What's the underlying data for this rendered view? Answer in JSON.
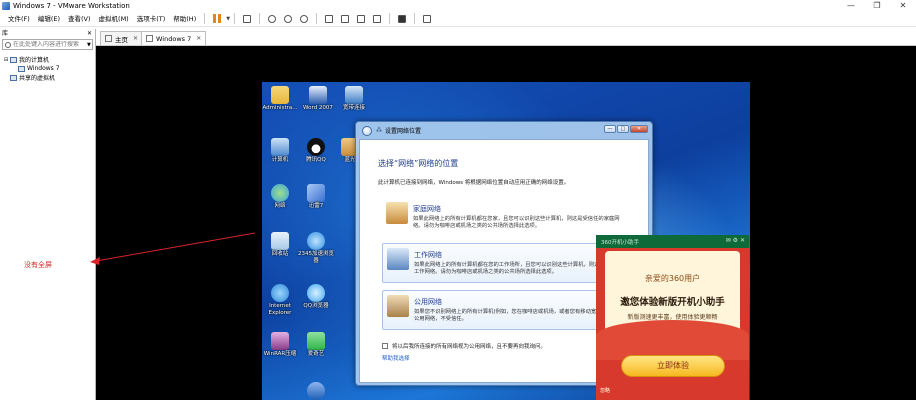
{
  "window": {
    "title": "Windows 7 - VMware Workstation",
    "controls": [
      "—",
      "❐",
      "✕"
    ]
  },
  "menu": {
    "items": [
      "文件(F)",
      "编辑(E)",
      "查看(V)",
      "虚拟机(M)",
      "选项卡(T)",
      "帮助(H)"
    ]
  },
  "library": {
    "header": "库",
    "close": "✕",
    "search_placeholder": "在此处键入内容进行搜索",
    "tree": [
      {
        "label": "我的计算机",
        "twisty": "⊟"
      },
      {
        "label": "Windows 7",
        "twisty": ""
      },
      {
        "label": "共享的虚拟机",
        "twisty": ""
      }
    ]
  },
  "annotation": {
    "text": "没有全屏",
    "color": "#d8232a"
  },
  "tabs": [
    {
      "label": "主页",
      "close": "✕"
    },
    {
      "label": "Windows 7",
      "close": "✕"
    }
  ],
  "desktop_icons": [
    {
      "label": "Administra...",
      "icon": "folder-icon",
      "color": "#e7b53b"
    },
    {
      "label": "Word 2007",
      "icon": "word-icon",
      "color": "#2b5cad"
    },
    {
      "label": "宽带连接",
      "icon": "network-icon",
      "color": "#3b7cc4"
    },
    {
      "label": "计算机",
      "icon": "computer-icon",
      "color": "#4d8ad0"
    },
    {
      "label": "腾讯QQ",
      "icon": "qq-icon",
      "color": "#111111"
    },
    {
      "label": "蓝光",
      "icon": "app-icon",
      "color": "#c89040"
    },
    {
      "label": "网络",
      "icon": "globe-icon",
      "color": "#3aa0e0"
    },
    {
      "label": "迅雷7",
      "icon": "thunder-icon",
      "color": "#3b6fd1"
    },
    {
      "label": "回收站",
      "icon": "recycle-bin-icon",
      "color": "#a8c8e8"
    },
    {
      "label": "2345加速浏览器",
      "icon": "browser-icon",
      "color": "#2f8ee0"
    },
    {
      "label": "Internet Explorer",
      "icon": "ie-icon",
      "color": "#2b8ad6"
    },
    {
      "label": "QQ浏览器",
      "icon": "qq-browser-icon",
      "color": "#3ea5ef"
    },
    {
      "label": "WinRAR压缩",
      "icon": "winrar-icon",
      "color": "#8a3c8a"
    },
    {
      "label": "爱奇艺",
      "icon": "iqiyi-icon",
      "color": "#2fb54a"
    },
    {
      "label": "",
      "icon": "k-icon",
      "color": "#1e5fb5"
    }
  ],
  "dialog": {
    "title": "设置网络位置",
    "controls": [
      "—",
      "□",
      "✕"
    ],
    "heading": "选择“网络”网络的位置",
    "description": "此计算机已连接到网络，Windows 将根据网络位置自动应用正确的网络设置。",
    "options": [
      {
        "title": "家庭网络",
        "desc": "如果此网络上的所有计算机都在您家，且您可以识别这些计算机，则这是受信任的家庭网络。请勿为咖啡店或机场之类的公共场所选择此选项。",
        "icon": "house-icon"
      },
      {
        "title": "工作网络",
        "desc": "如果此网络上的所有计算机都在您的工作场所，且您可以识别这些计算机，则这是受信任的工作网络。请勿为咖啡店或机场之类的公共场所选择此选项。",
        "icon": "office-icon"
      },
      {
        "title": "公用网络",
        "desc": "如果您不识别网络上的所有计算机(例如，您在咖啡店或机场，或者您有移动宽带)，则这是公用网络，不受信任。",
        "icon": "bench-icon"
      }
    ],
    "checkbox": "将以后我所连接的所有网络视为公用网络，且不要再向我询问。",
    "link": "帮助我选择"
  },
  "popup": {
    "header": "360开机小助手",
    "hicons": "✉ ⚙ ✕",
    "hello": "亲爱的360用户",
    "main": "邀您体验新版开机小助手",
    "sub": "新版测速更丰富，使用体验更顺畅",
    "button": "立即体验",
    "footer": "忽略"
  }
}
